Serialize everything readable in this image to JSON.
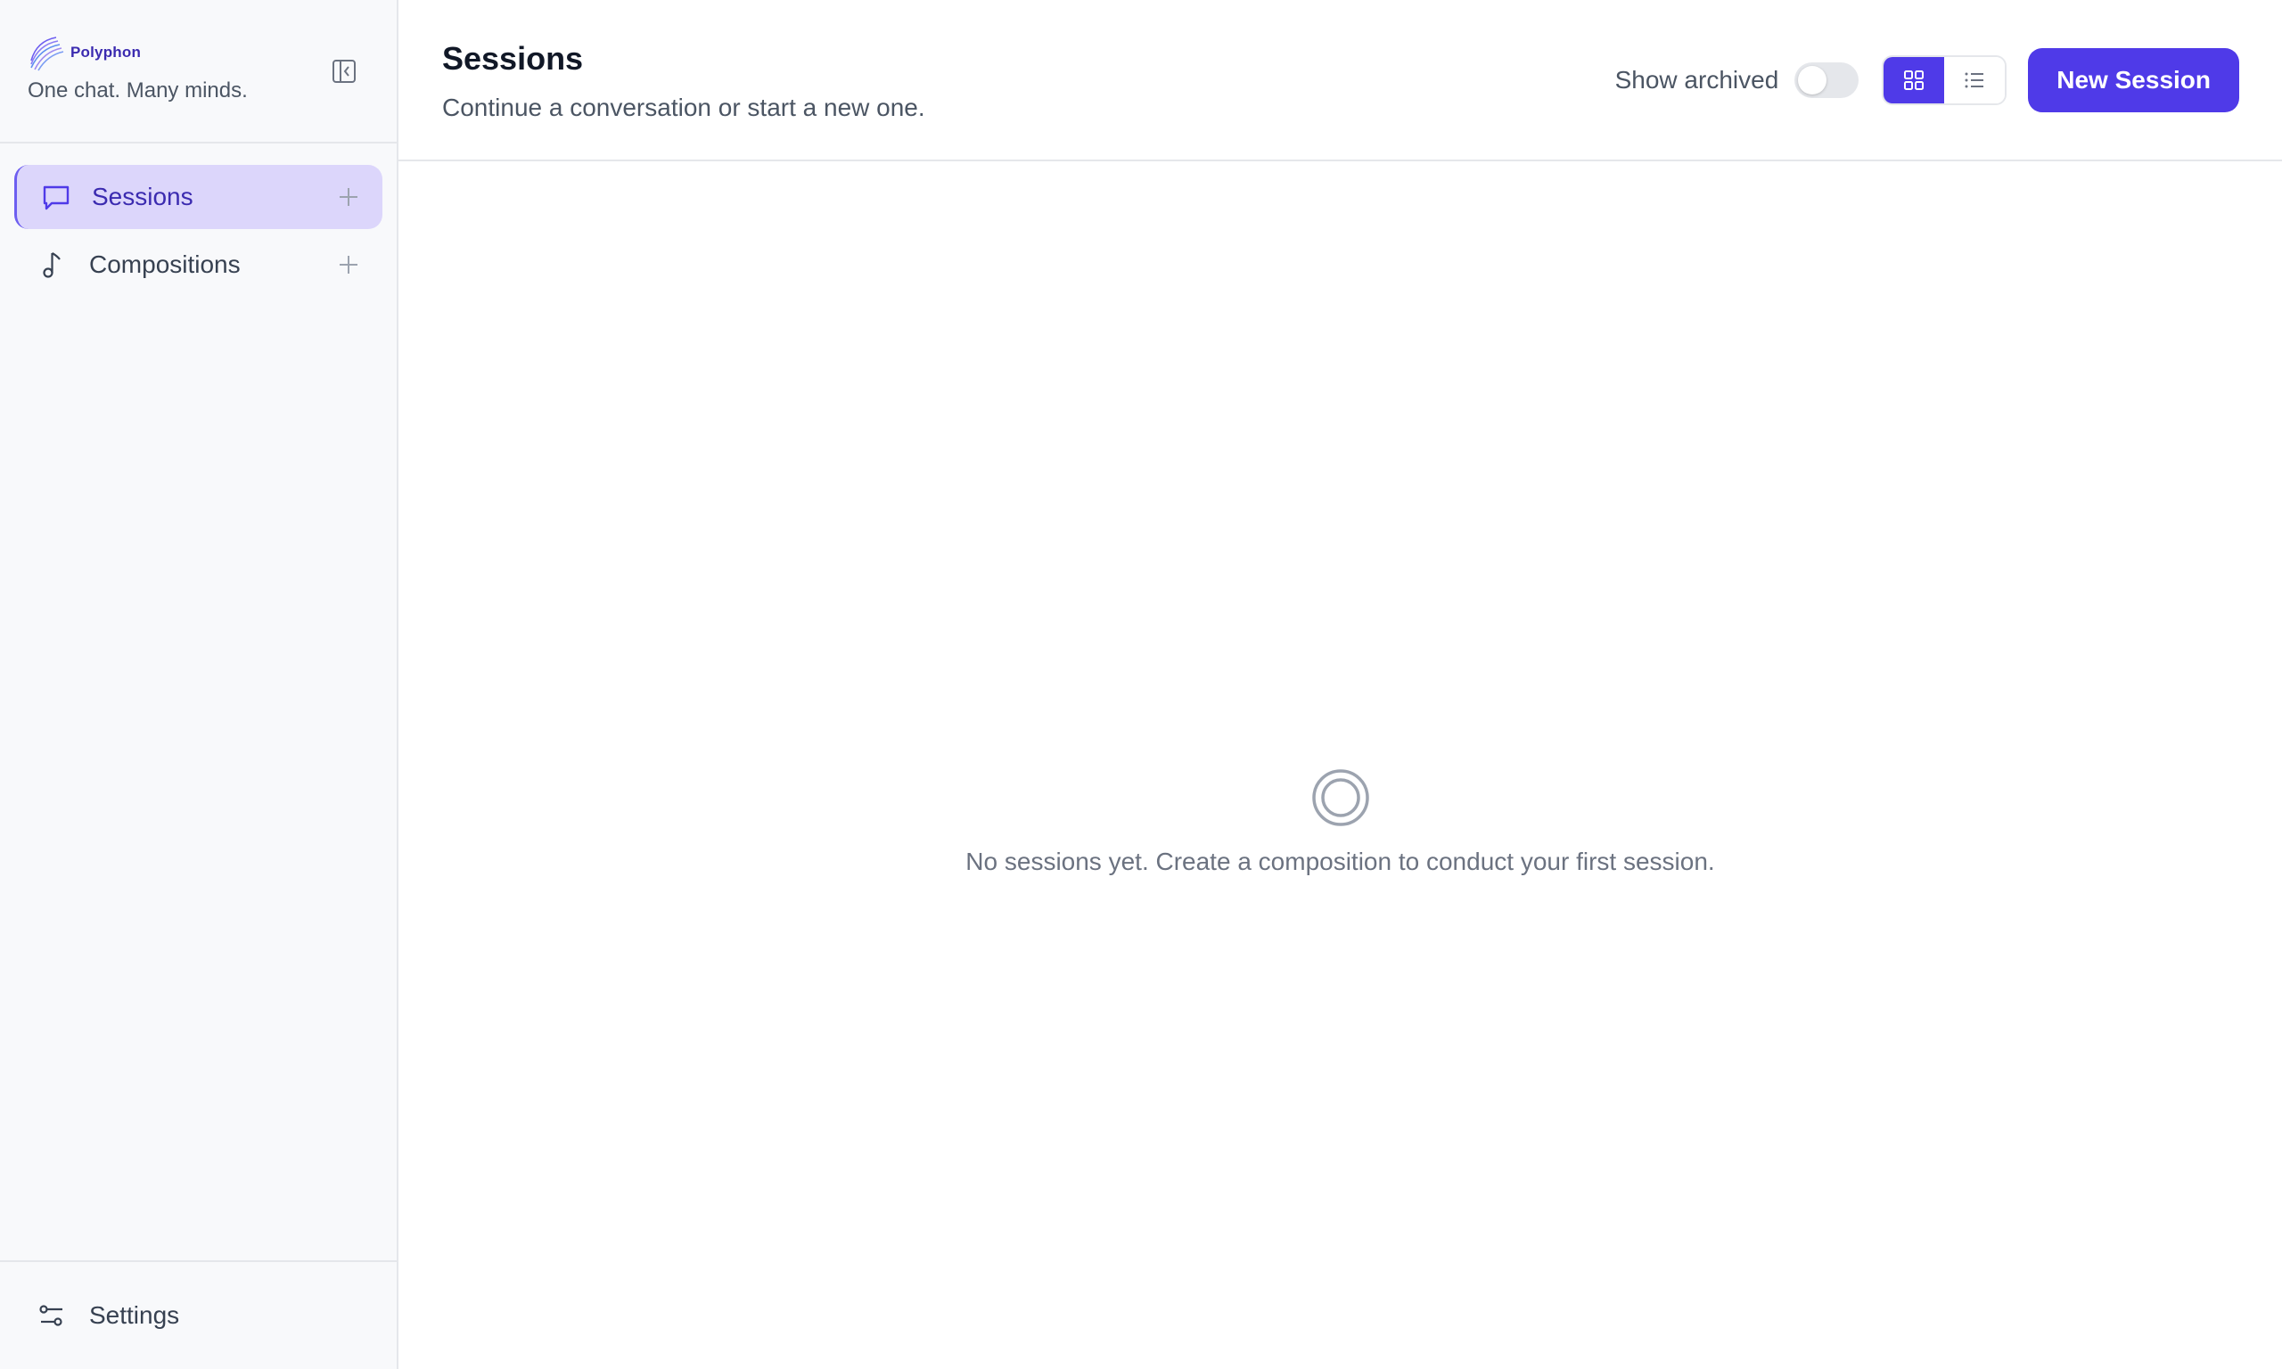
{
  "brand": {
    "name": "Polyphon",
    "tagline": "One chat. Many minds.",
    "accent": "#4f3ae8"
  },
  "sidebar": {
    "collapse_icon": "sidebar-collapse-icon",
    "items": [
      {
        "label": "Sessions",
        "icon": "chat-bubble-icon",
        "active": true
      },
      {
        "label": "Compositions",
        "icon": "music-note-icon",
        "active": false
      }
    ],
    "footer": {
      "label": "Settings",
      "icon": "sliders-icon"
    }
  },
  "header": {
    "title": "Sessions",
    "subtitle": "Continue a conversation or start a new one.",
    "show_archived_label": "Show archived",
    "show_archived": false,
    "view_mode": "grid",
    "new_button_label": "New Session"
  },
  "empty_state": {
    "icon": "empty-circle-icon",
    "message": "No sessions yet. Create a composition to conduct your first session."
  }
}
